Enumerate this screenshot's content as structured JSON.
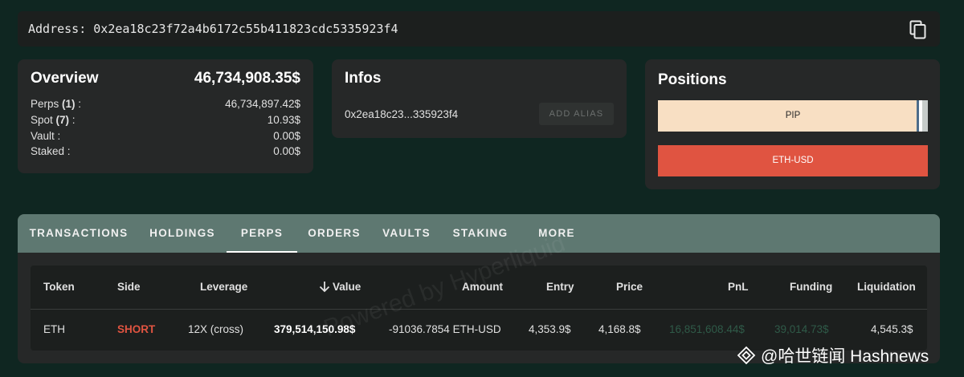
{
  "address_bar": {
    "label": "Address: 0x2ea18c23f72a4b6172c55b411823cdc5335923f4",
    "icon": "copy-icon"
  },
  "overview": {
    "title": "Overview",
    "total": "46,734,908.35$",
    "rows": [
      {
        "label_pre": "Perps ",
        "count": "(1)",
        "label_post": " :",
        "value": "46,734,897.42$"
      },
      {
        "label_pre": "Spot ",
        "count": "(7)",
        "label_post": " :",
        "value": "10.93$"
      },
      {
        "label_pre": "Vault :",
        "count": "",
        "label_post": "",
        "value": "0.00$"
      },
      {
        "label_pre": "Staked :",
        "count": "",
        "label_post": "",
        "value": "0.00$"
      }
    ]
  },
  "infos": {
    "title": "Infos",
    "address_short": "0x2ea18c23...335923f4",
    "alias_button": "ADD ALIAS"
  },
  "positions": {
    "title": "Positions",
    "bars": [
      {
        "label": "PIP",
        "color": "#f8dfc3"
      },
      {
        "label": "ETH-USD",
        "color": "#e05441"
      }
    ]
  },
  "tabs": [
    {
      "label": "TRANSACTIONS",
      "active": false
    },
    {
      "label": "HOLDINGS",
      "active": false
    },
    {
      "label": "PERPS",
      "active": true
    },
    {
      "label": "ORDERS",
      "active": false
    },
    {
      "label": "VAULTS",
      "active": false
    },
    {
      "label": "STAKING",
      "active": false
    },
    {
      "label": "MORE",
      "active": false
    }
  ],
  "table": {
    "sort_icon": "arrow-down-icon",
    "headers": {
      "token": "Token",
      "side": "Side",
      "leverage": "Leverage",
      "value": "Value",
      "amount": "Amount",
      "entry": "Entry",
      "price": "Price",
      "pnl": "PnL",
      "funding": "Funding",
      "liquidation": "Liquidation"
    },
    "rows": [
      {
        "token": "ETH",
        "side": "SHORT",
        "leverage": "12X (cross)",
        "value": "379,514,150.98$",
        "amount": "-91036.7854 ETH-USD",
        "entry": "4,353.9$",
        "price": "4,168.8$",
        "pnl": "16,851,608.44$",
        "funding": "39,014.73$",
        "liquidation": "4,545.3$"
      }
    ]
  },
  "watermark": {
    "background": "Powered by Hyperliquid",
    "brand": "@哈世链闻 Hashnews"
  },
  "colors": {
    "background": "#0f2621",
    "card": "#262828",
    "tab_bar": "#5e7871",
    "short": "#e05441",
    "pnl_positive": "#2f5a48"
  }
}
